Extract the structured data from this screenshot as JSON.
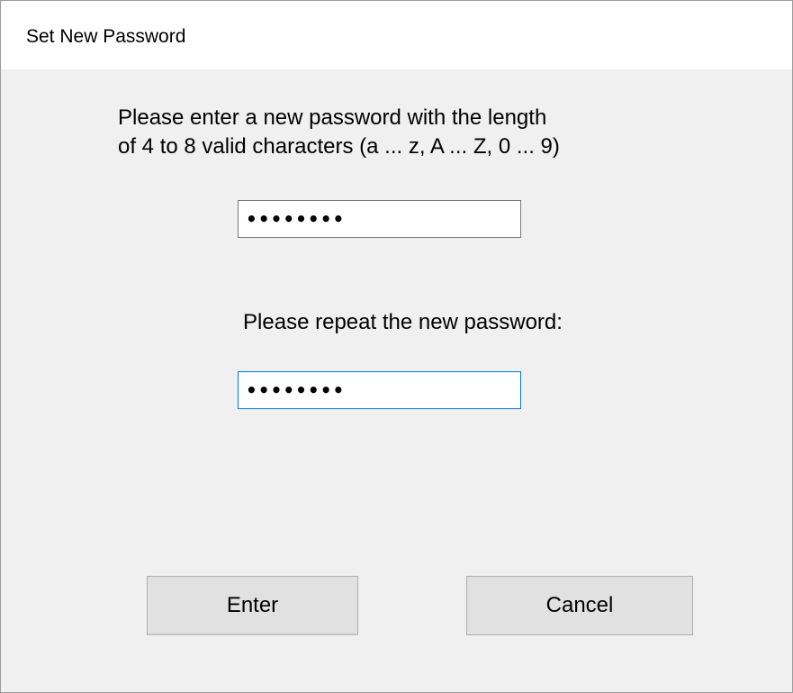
{
  "window": {
    "title": "Set New Password"
  },
  "instructions": {
    "text": "Please enter a new password with the length\nof 4 to 8 valid characters (a ... z, A ... Z, 0 ... 9)"
  },
  "new_password": {
    "masked_value": "••••••••"
  },
  "repeat": {
    "label": "Please repeat the new password:",
    "masked_value": "••••••••"
  },
  "buttons": {
    "enter_label": "Enter",
    "cancel_label": "Cancel"
  },
  "colors": {
    "background": "#f0f0f0",
    "titlebar": "#ffffff",
    "focus_border": "#0078d7",
    "button_face": "#e1e1e1"
  }
}
